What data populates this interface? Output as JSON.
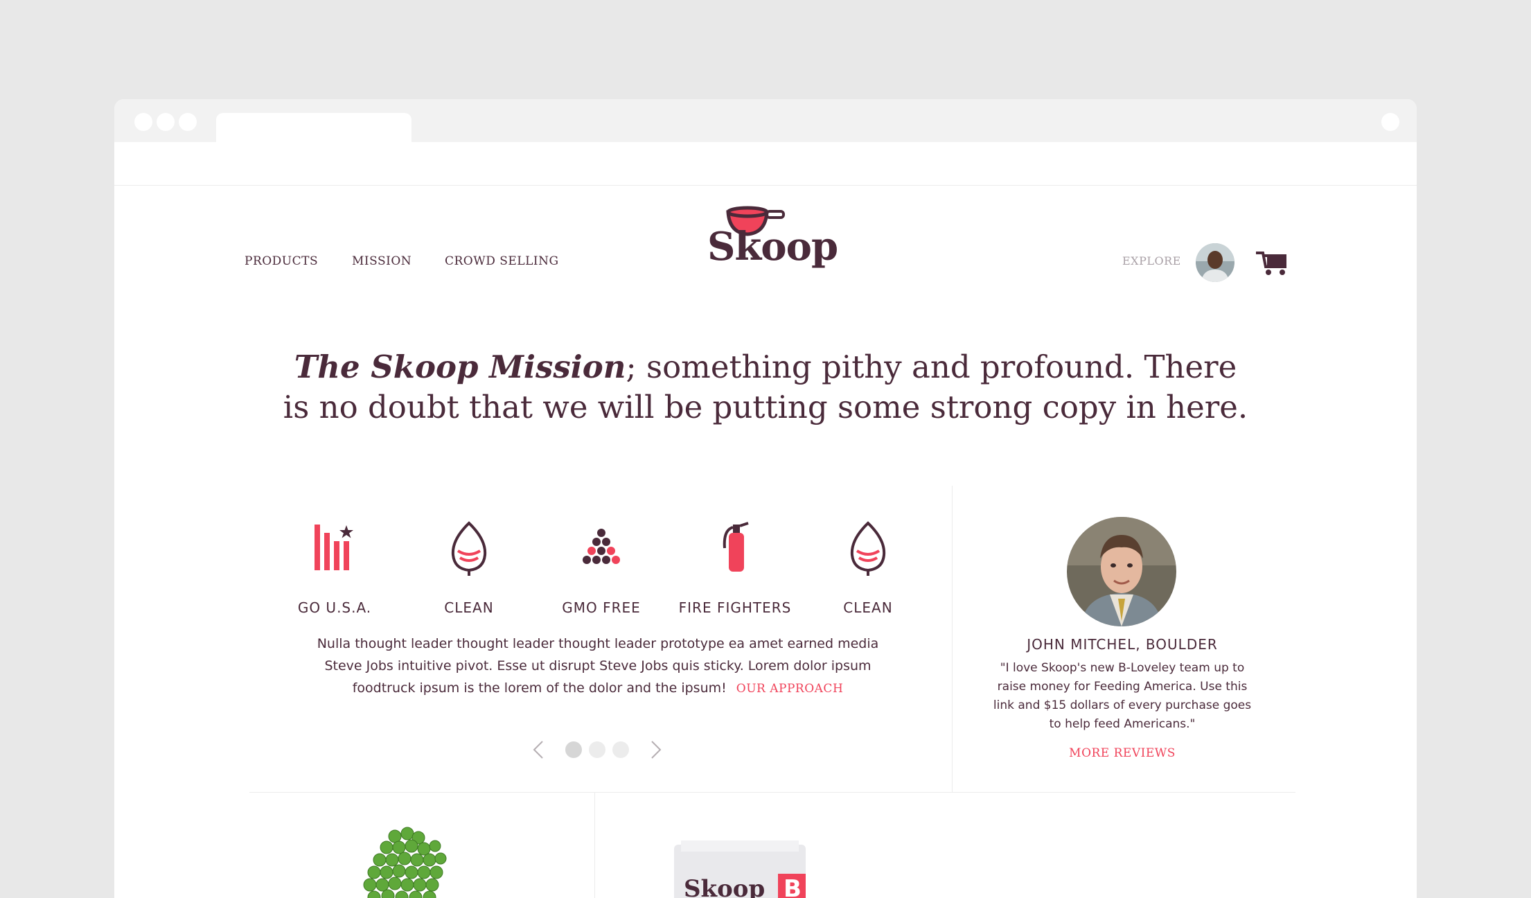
{
  "nav": {
    "links": [
      "PRODUCTS",
      "MISSION",
      "CROWD SELLING"
    ],
    "explore": "EXPLORE"
  },
  "logo": {
    "text": "Skoop"
  },
  "mission": {
    "title": "The Skoop Mission",
    "text": "; something pithy and profound. There is no doubt that we will be putting some strong copy in here."
  },
  "features": {
    "items": [
      {
        "label": "GO U.S.A.",
        "icon": "flag-bars-icon"
      },
      {
        "label": "CLEAN",
        "icon": "leaf-drop-icon"
      },
      {
        "label": "GMO FREE",
        "icon": "dots-triangle-icon"
      },
      {
        "label": "FIRE FIGHTERS",
        "icon": "fire-extinguisher-icon"
      },
      {
        "label": "CLEAN",
        "icon": "leaf-drop-icon"
      }
    ],
    "description": "Nulla thought leader thought leader thought leader prototype ea amet earned media Steve Jobs intuitive pivot. Esse ut disrupt Steve Jobs quis sticky. Lorem dolor ipsum foodtruck ipsum is the lorem of the dolor and the ipsum!",
    "link": "OUR APPROACH",
    "pager": {
      "pages": 3,
      "current": 1
    }
  },
  "review": {
    "name": "JOHN MITCHEL, BOULDER",
    "quote": "\"I love Skoop's new B-Loveley team up to raise money for Feeding America. Use this link and $15 dollars of every purchase goes to help feed Americans.\"",
    "link": "MORE REVIEWS"
  },
  "products": {
    "bag_label": "Skoop",
    "bag_badge": "B"
  },
  "colors": {
    "accent": "#f0435a",
    "text": "#4a2a3a",
    "muted": "#a9a0a6",
    "background": "#e8e8e8"
  }
}
